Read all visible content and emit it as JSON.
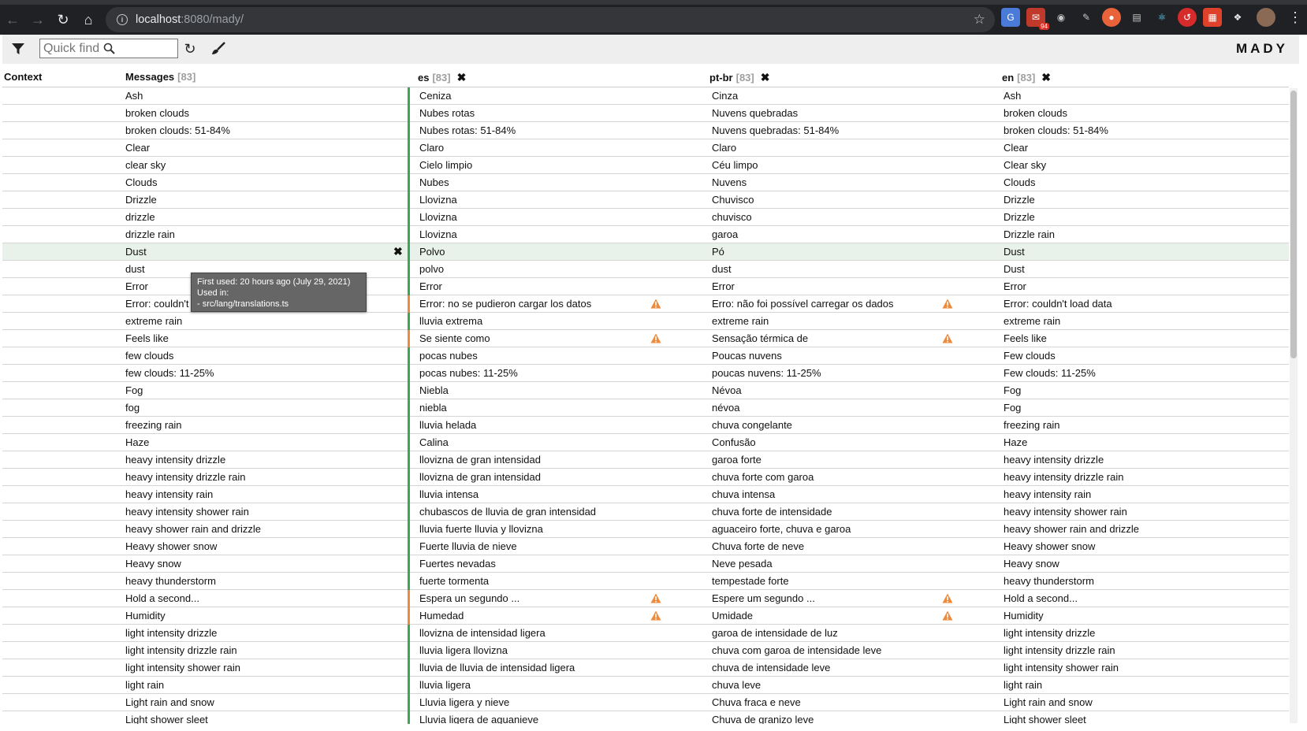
{
  "browser": {
    "url_host": "localhost",
    "url_rest": ":8080/mady/",
    "ext_badge": "94"
  },
  "toolbar": {
    "quick_find_placeholder": "Quick find",
    "brand": "MADY"
  },
  "header": {
    "context": "Context",
    "messages": "Messages",
    "messages_count": "[83]",
    "es": "es",
    "es_count": "[83]",
    "ptbr": "pt-br",
    "ptbr_count": "[83]",
    "en": "en",
    "en_count": "[83]"
  },
  "tooltip": {
    "line1": "First used: 20 hours ago (July 29, 2021)",
    "line2": "Used in:",
    "line3": "- src/lang/translations.ts"
  },
  "colors": {
    "ok": "#3aa657",
    "warn": "#ef8a3c",
    "highlight": "#e8f2ea"
  },
  "rows": [
    {
      "msg": "Ash",
      "es": "Ceniza",
      "pt": "Cinza",
      "en": "Ash"
    },
    {
      "msg": "broken clouds",
      "es": "Nubes rotas",
      "pt": "Nuvens quebradas",
      "en": "broken clouds"
    },
    {
      "msg": "broken clouds: 51-84%",
      "es": "Nubes rotas: 51-84%",
      "pt": "Nuvens quebradas: 51-84%",
      "en": "broken clouds: 51-84%"
    },
    {
      "msg": "Clear",
      "es": "Claro",
      "pt": "Claro",
      "en": "Clear"
    },
    {
      "msg": "clear sky",
      "es": "Cielo limpio",
      "pt": "Céu limpo",
      "en": "Clear sky"
    },
    {
      "msg": "Clouds",
      "es": "Nubes",
      "pt": "Nuvens",
      "en": "Clouds"
    },
    {
      "msg": "Drizzle",
      "es": "Llovizna",
      "pt": "Chuvisco",
      "en": "Drizzle"
    },
    {
      "msg": "drizzle",
      "es": "Llovizna",
      "pt": "chuvisco",
      "en": "Drizzle"
    },
    {
      "msg": "drizzle rain",
      "es": "Llovizna",
      "pt": "garoa",
      "en": "Drizzle rain"
    },
    {
      "msg": "Dust",
      "es": "Polvo",
      "pt": "Pó",
      "en": "Dust",
      "hl": true
    },
    {
      "msg": "dust",
      "es": "polvo",
      "pt": "dust",
      "en": "Dust"
    },
    {
      "msg": "Error",
      "es": "Error",
      "pt": "Error",
      "en": "Error"
    },
    {
      "msg": "Error: couldn't load data",
      "es": "Error: no se pudieron cargar los datos",
      "pt": "Erro: não foi possível carregar os dados",
      "en": "Error: couldn't load data",
      "warn": true
    },
    {
      "msg": "extreme rain",
      "es": "lluvia extrema",
      "pt": "extreme rain",
      "en": "extreme rain"
    },
    {
      "msg": "Feels like",
      "es": "Se siente como",
      "pt": "Sensação térmica de",
      "en": "Feels like",
      "warn": true
    },
    {
      "msg": "few clouds",
      "es": "pocas nubes",
      "pt": "Poucas nuvens",
      "en": "Few clouds"
    },
    {
      "msg": "few clouds: 11-25%",
      "es": "pocas nubes: 11-25%",
      "pt": "poucas nuvens: 11-25%",
      "en": "Few clouds: 11-25%"
    },
    {
      "msg": "Fog",
      "es": "Niebla",
      "pt": "Névoa",
      "en": "Fog"
    },
    {
      "msg": "fog",
      "es": "niebla",
      "pt": "névoa",
      "en": "Fog"
    },
    {
      "msg": "freezing rain",
      "es": "lluvia helada",
      "pt": "chuva congelante",
      "en": "freezing rain"
    },
    {
      "msg": "Haze",
      "es": "Calina",
      "pt": "Confusão",
      "en": "Haze"
    },
    {
      "msg": "heavy intensity drizzle",
      "es": "llovizna de gran intensidad",
      "pt": "garoa forte",
      "en": "heavy intensity drizzle"
    },
    {
      "msg": "heavy intensity drizzle rain",
      "es": "llovizna de gran intensidad",
      "pt": "chuva forte com garoa",
      "en": "heavy intensity drizzle rain"
    },
    {
      "msg": "heavy intensity rain",
      "es": "lluvia intensa",
      "pt": "chuva intensa",
      "en": "heavy intensity rain"
    },
    {
      "msg": "heavy intensity shower rain",
      "es": "chubascos de lluvia de gran intensidad",
      "pt": "chuva forte de intensidade",
      "en": "heavy intensity shower rain"
    },
    {
      "msg": "heavy shower rain and drizzle",
      "es": "lluvia fuerte lluvia y llovizna",
      "pt": "aguaceiro forte, chuva e garoa",
      "en": "heavy shower rain and drizzle"
    },
    {
      "msg": "Heavy shower snow",
      "es": "Fuerte lluvia de nieve",
      "pt": "Chuva forte de neve",
      "en": "Heavy shower snow"
    },
    {
      "msg": "Heavy snow",
      "es": "Fuertes nevadas",
      "pt": "Neve pesada",
      "en": "Heavy snow"
    },
    {
      "msg": "heavy thunderstorm",
      "es": "fuerte tormenta",
      "pt": "tempestade forte",
      "en": "heavy thunderstorm"
    },
    {
      "msg": "Hold a second...",
      "es": "Espera un segundo ...",
      "pt": "Espere um segundo ...",
      "en": "Hold a second...",
      "warn": true
    },
    {
      "msg": "Humidity",
      "es": "Humedad",
      "pt": "Umidade",
      "en": "Humidity",
      "warn": true
    },
    {
      "msg": "light intensity drizzle",
      "es": "llovizna de intensidad ligera",
      "pt": "garoa de intensidade de luz",
      "en": "light intensity drizzle"
    },
    {
      "msg": "light intensity drizzle rain",
      "es": "lluvia ligera llovizna",
      "pt": "chuva com garoa de intensidade leve",
      "en": "light intensity drizzle rain"
    },
    {
      "msg": "light intensity shower rain",
      "es": "lluvia de lluvia de intensidad ligera",
      "pt": "chuva de intensidade leve",
      "en": "light intensity shower rain"
    },
    {
      "msg": "light rain",
      "es": "lluvia ligera",
      "pt": "chuva leve",
      "en": "light rain"
    },
    {
      "msg": "Light rain and snow",
      "es": "Lluvia ligera y nieve",
      "pt": "Chuva fraca e neve",
      "en": "Light rain and snow"
    },
    {
      "msg": "Light shower sleet",
      "es": "Lluvia ligera de aguanieve",
      "pt": "Chuva de granizo leve",
      "en": "Light shower sleet"
    }
  ]
}
